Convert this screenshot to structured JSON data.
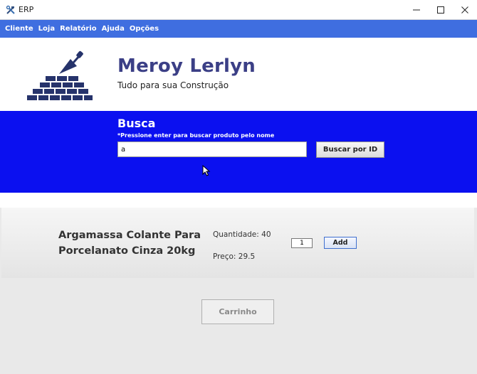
{
  "window": {
    "title": "ERP",
    "icon": "tools-icon",
    "controls": [
      "minimize-icon",
      "maximize-icon",
      "close-icon"
    ]
  },
  "menu": {
    "items": [
      "Cliente",
      "Loja",
      "Relatório",
      "Ajuda",
      "Opções"
    ]
  },
  "header": {
    "logo": "bricks-trowel-icon",
    "brand": "Meroy Lerlyn",
    "tagline": "Tudo para sua Construção"
  },
  "search": {
    "title": "Busca",
    "hint": "*Pressione enter para buscar produto pelo nome",
    "input_value": "a",
    "button_label": "Buscar por ID"
  },
  "product": {
    "name": "Argamassa Colante Para Porcelanato Cinza 20kg",
    "quantity_label": "Quantidade: 40",
    "price_label": "Preço: 29.5",
    "qty_input_value": "1",
    "add_label": "Add"
  },
  "cart": {
    "label": "Carrinho"
  },
  "colors": {
    "menu_bg": "#3f6ee0",
    "search_bg": "#0b10f0",
    "brand": "#3b3f86",
    "logo": "#26336b"
  }
}
